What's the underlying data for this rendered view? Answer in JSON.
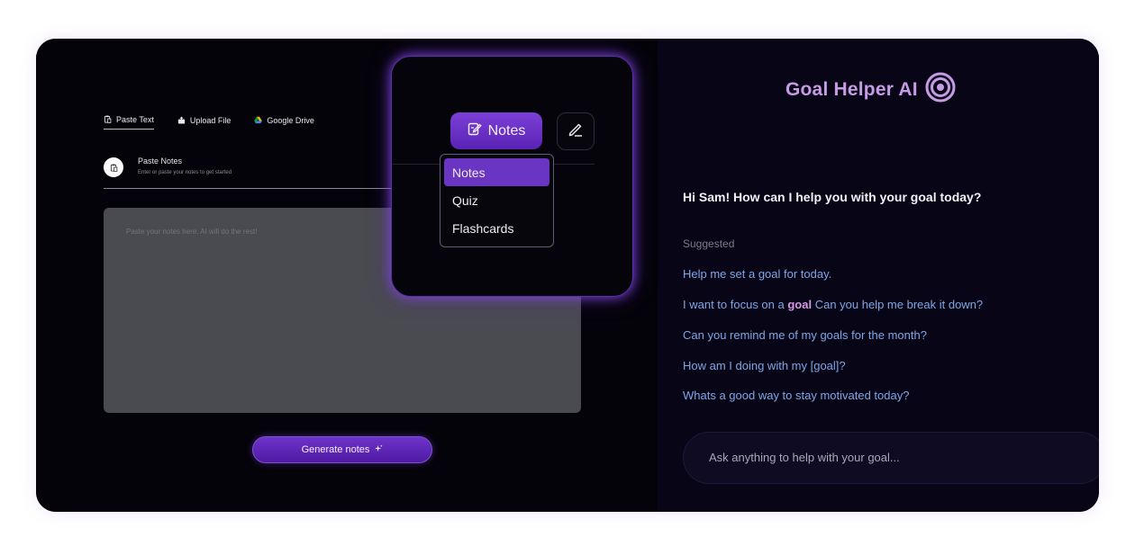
{
  "source_tabs": [
    {
      "label": "Paste Text",
      "icon": "clipboard-icon",
      "active": true
    },
    {
      "label": "Upload File",
      "icon": "upload-icon",
      "active": false
    },
    {
      "label": "Google Drive",
      "icon": "google-drive-icon",
      "active": false
    }
  ],
  "paste_section": {
    "title": "Paste Notes",
    "subtitle": "Enter or paste your notes to get started",
    "placeholder": "Paste your notes here. AI will do the rest!"
  },
  "generate_button": {
    "label": "Generate notes",
    "icon": "sparkle-icon"
  },
  "mode_menu": {
    "selected_label": "Notes",
    "icon": "notes-edit-icon",
    "options": [
      "Notes",
      "Quiz",
      "Flashcards"
    ],
    "edit_icon": "pen-icon"
  },
  "assistant": {
    "title": "Goal Helper AI",
    "logo_icon": "target-icon",
    "greeting": "Hi Sam! How can I help you with your goal today?",
    "suggested_label": "Suggested",
    "suggestions": [
      {
        "before": "Help me set a goal for today.",
        "highlight": "",
        "after": ""
      },
      {
        "before": "I want to focus on a ",
        "highlight": "goal",
        "after": " Can you help me break it down?"
      },
      {
        "before": "Can you remind me of my goals for the month?",
        "highlight": "",
        "after": ""
      },
      {
        "before": "How am I doing with my [goal]?",
        "highlight": "",
        "after": ""
      },
      {
        "before": "Whats a good way to stay motivated today?",
        "highlight": "",
        "after": ""
      }
    ],
    "input_placeholder": "Ask anything to help with your goal..."
  },
  "colors": {
    "accent_purple": "#6a35c2",
    "brand_pink": "#c79be6",
    "suggestion_blue": "#7fa6e6",
    "panel_bg": "#040309"
  }
}
